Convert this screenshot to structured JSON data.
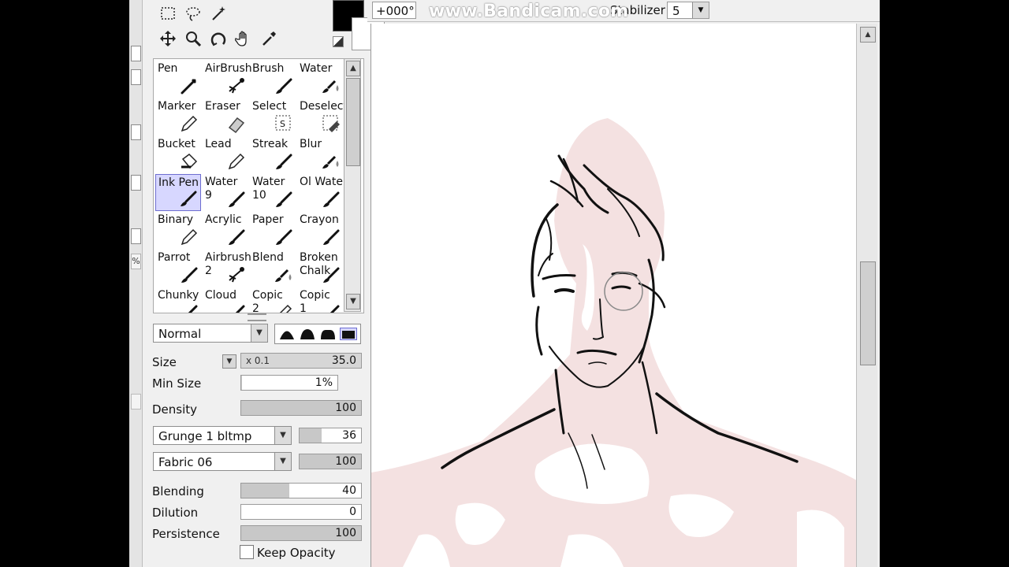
{
  "toolbar": {
    "tools": [
      "rect-select-icon",
      "lasso-icon",
      "magic-wand-icon",
      "move-icon",
      "zoom-icon",
      "rotate-icon",
      "hand-icon",
      "eyedropper-icon"
    ]
  },
  "colors": {
    "foreground": "#000000",
    "background": "#ffffff",
    "skin": "#f2dcdc",
    "accent": "#d7d7ff"
  },
  "brushes": [
    {
      "name": "Pen",
      "icon": "pen-icon"
    },
    {
      "name": "AirBrush",
      "icon": "airbrush-icon"
    },
    {
      "name": "Brush",
      "icon": "brush-icon"
    },
    {
      "name": "Water",
      "icon": "water-icon"
    },
    {
      "name": "Marker",
      "icon": "pencil-icon"
    },
    {
      "name": "Eraser",
      "icon": "eraser-icon"
    },
    {
      "name": "Select",
      "icon": "select-icon"
    },
    {
      "name": "Deselect",
      "icon": "deselect-icon"
    },
    {
      "name": "Bucket",
      "icon": "bucket-icon"
    },
    {
      "name": "Lead",
      "icon": "pencil-icon"
    },
    {
      "name": "Streak",
      "icon": "brush-icon"
    },
    {
      "name": "Blur",
      "icon": "water-icon"
    },
    {
      "name": "Ink Pen",
      "icon": "brush-icon",
      "selected": true
    },
    {
      "name": "Water\n9",
      "icon": "brush-icon"
    },
    {
      "name": "Water\n10",
      "icon": "brush-icon"
    },
    {
      "name": "Ol Water",
      "icon": "brush-icon"
    },
    {
      "name": "Binary",
      "icon": "pencil-icon"
    },
    {
      "name": "Acrylic",
      "icon": "brush-icon"
    },
    {
      "name": "Paper",
      "icon": "brush-icon"
    },
    {
      "name": "Crayon",
      "icon": "brush-icon"
    },
    {
      "name": "Parrot",
      "icon": "brush-icon"
    },
    {
      "name": "Airbrush\n2",
      "icon": "airbrush-icon"
    },
    {
      "name": "Blend",
      "icon": "water-icon"
    },
    {
      "name": "Broken\nChalk",
      "icon": "brush-icon"
    },
    {
      "name": "Chunky",
      "icon": "brush-icon"
    },
    {
      "name": "Cloud",
      "icon": "brush-icon"
    },
    {
      "name": "Copic\n2",
      "icon": "pencil-icon"
    },
    {
      "name": "Copic\n1",
      "icon": "brush-icon"
    }
  ],
  "blend_mode": "Normal",
  "size": {
    "label": "Size",
    "multiplier": "x 0.1",
    "value": "35.0"
  },
  "min_size": {
    "label": "Min Size",
    "value": "1%",
    "fraction": 0.01
  },
  "density": {
    "label": "Density",
    "value": "100",
    "fraction": 1.0
  },
  "texture1": {
    "name": "Grunge 1 bltmp",
    "value": "36",
    "fraction": 0.36
  },
  "texture2": {
    "name": "Fabric 06",
    "value": "100",
    "fraction": 1.0
  },
  "blending": {
    "label": "Blending",
    "value": "40",
    "fraction": 0.4
  },
  "dilution": {
    "label": "Dilution",
    "value": "0",
    "fraction": 0.0
  },
  "persistence": {
    "label": "Persistence",
    "value": "100",
    "fraction": 1.0
  },
  "keep_opacity": {
    "label": "Keep Opacity",
    "checked": false
  },
  "canvas_bar": {
    "angle": "+000°",
    "stabilizer_label": "Stabilizer",
    "stabilizer_value": "5"
  },
  "watermark": "www.Bandicam.com",
  "strip_tabs": [
    "%"
  ]
}
